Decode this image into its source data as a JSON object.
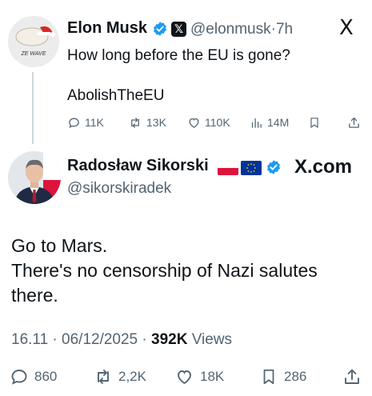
{
  "tweet1": {
    "author_name": "Elon Musk",
    "handle": "@elonmusk",
    "separator": "·",
    "time": "7h",
    "line1": "How long before the EU is gone?",
    "line2": "AbolishTheEU",
    "avatar_caption": "ZE WAVE",
    "close_glyph": "X",
    "replies": "11K",
    "reposts": "13K",
    "likes": "110K",
    "views": "14M"
  },
  "tweet2": {
    "author_name": "Radosław Sikorski",
    "handle": "@sikorskiradek",
    "brand": "X.com",
    "body_line1": "Go to Mars.",
    "body_line2": "There's no censorship of Nazi salutes",
    "body_line3": "there.",
    "time": "16.11",
    "separator": "·",
    "date": "06/12/2025",
    "separator2": "·",
    "views_count": "392K",
    "views_label": "Views",
    "replies": "860",
    "reposts": "2,2K",
    "likes": "18K",
    "bookmarks": "286"
  },
  "colors": {
    "text": "#0f1419",
    "secondary": "#536471",
    "verified_blue": "#1d9bf0",
    "thread_line": "#cfd9de"
  }
}
